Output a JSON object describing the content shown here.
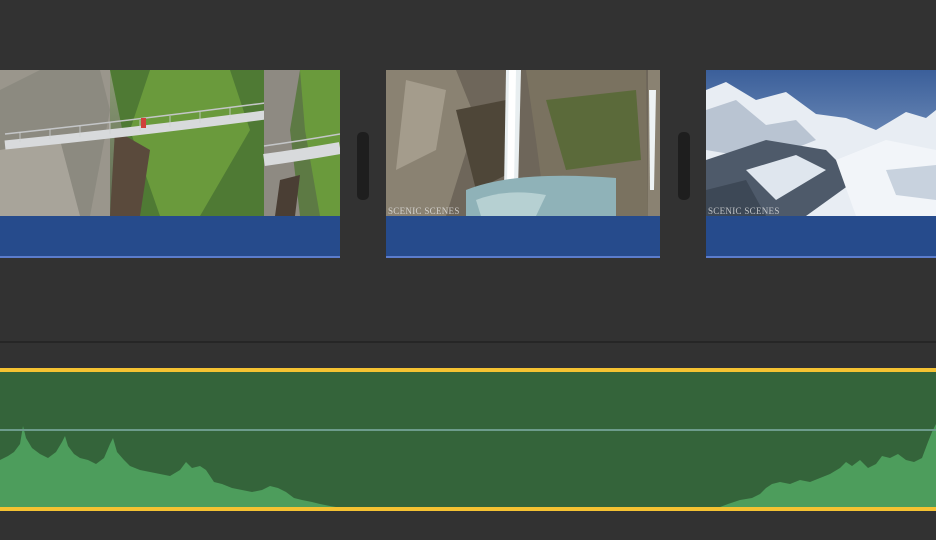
{
  "timeline": {
    "clips": [
      {
        "id": "clip-bridge",
        "caption": ""
      },
      {
        "id": "clip-waterfall",
        "caption": "Scenic Scenes"
      },
      {
        "id": "clip-mountains",
        "caption": "Scenic Scenes"
      }
    ],
    "audio_track": {
      "volume_level": 0.6,
      "accent_color": "#f4c232",
      "fill_color": "#34643a",
      "wave_color": "#4d9d5c"
    },
    "video_bar_color": "#264b8c"
  }
}
